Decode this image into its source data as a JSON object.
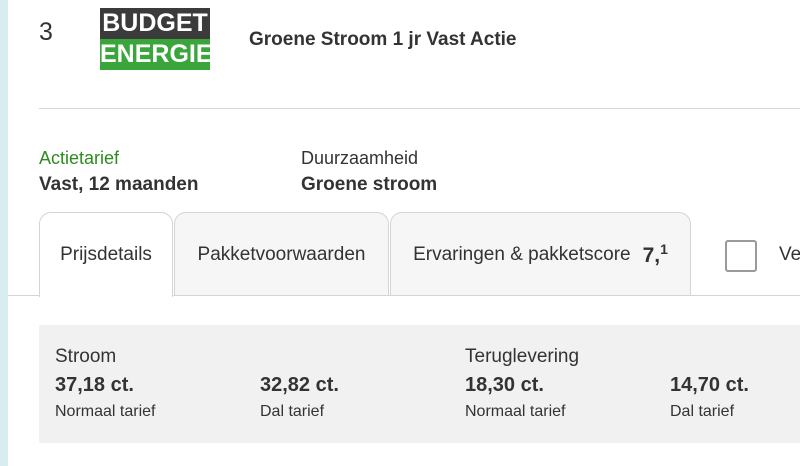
{
  "rank": "3",
  "provider": {
    "logo_top": "BUDGET",
    "logo_bottom": "ENERGIE",
    "logo_colors": {
      "top_bg": "#3b3b3b",
      "bottom_bg": "#3aa53a"
    }
  },
  "product_name": "Groene Stroom 1 jr Vast Actie",
  "info": {
    "tariff_label": "Actietarief",
    "tariff_value": "Vast, 12 maanden",
    "sustainability_label": "Duurzaamheid",
    "sustainability_value": "Groene stroom"
  },
  "tabs": [
    {
      "label": "Prijsdetails",
      "active": true
    },
    {
      "label": "Pakketvoorwaarden",
      "active": false
    },
    {
      "label": "Ervaringen & pakketscore",
      "active": false,
      "score_main": "7,",
      "score_sub": "1"
    }
  ],
  "compare": {
    "label": "Ve",
    "checked": false
  },
  "prices": {
    "stroom": {
      "title": "Stroom",
      "normal_value": "37,18 ct.",
      "normal_label": "Normaal tarief",
      "low_value": "32,82 ct.",
      "low_label": "Dal tarief"
    },
    "teruglevering": {
      "title": "Teruglevering",
      "normal_value": "18,30 ct.",
      "normal_label": "Normaal tarief",
      "low_value": "14,70 ct.",
      "low_label": "Dal tarief"
    }
  },
  "colors": {
    "accent_green": "#2e8b1f",
    "panel_bg": "#f1f1f1"
  }
}
